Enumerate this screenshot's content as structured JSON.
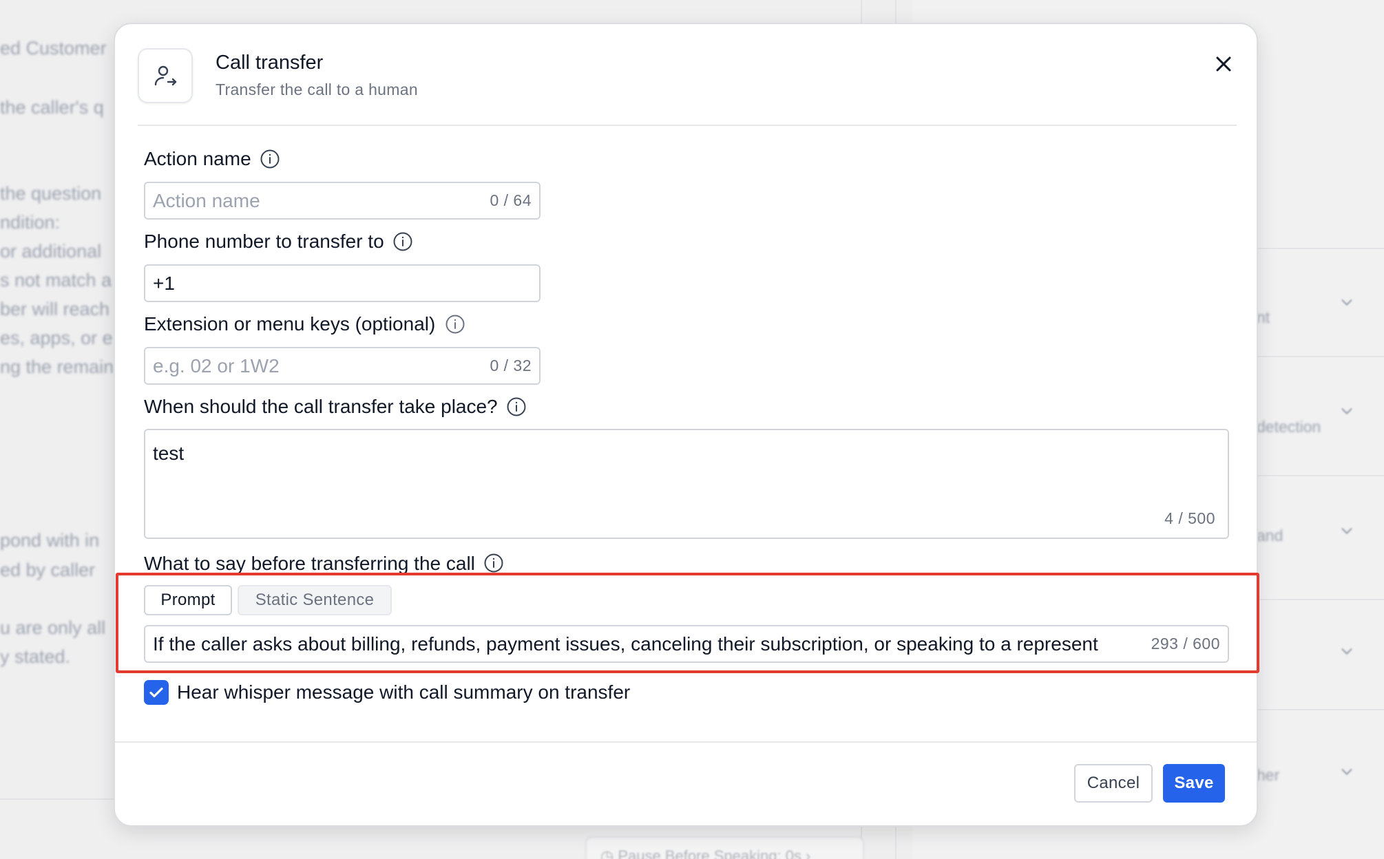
{
  "background": {
    "left_lines": [
      "ed Customer",
      "the caller's q",
      "the question",
      "ndition:",
      "or additional",
      "s not match a",
      "ber will reach",
      "es, apps, or e",
      "ng the remain",
      "pond with in",
      "ed by caller",
      "u are only all",
      "y stated."
    ],
    "right_items": [
      "nt",
      "detection",
      "and",
      "",
      "her"
    ],
    "pause_pill": "Pause Before Speaking: 0s"
  },
  "modal": {
    "title": "Call transfer",
    "subtitle": "Transfer the call to a human",
    "icon": "user-transfer-icon",
    "close_icon": "close-icon"
  },
  "form": {
    "action_name": {
      "label": "Action name",
      "placeholder": "Action name",
      "value": "",
      "counter": "0 / 64"
    },
    "phone": {
      "label": "Phone number to transfer to",
      "value": "+1"
    },
    "extension": {
      "label": "Extension or menu keys (optional)",
      "placeholder": "e.g. 02 or 1W2",
      "counter": "0 / 32"
    },
    "when": {
      "label": "When should the call transfer take place?",
      "value": "test",
      "counter": "4 / 500"
    },
    "say": {
      "label": "What to say before transferring the call",
      "tabs": [
        "Prompt",
        "Static Sentence"
      ],
      "active_tab": "Prompt",
      "value": "If the caller asks about billing, refunds, payment issues, canceling their subscription, or speaking to a represent",
      "counter": "293 / 600"
    },
    "whisper": {
      "label": "Hear whisper message with call summary on transfer",
      "checked": true
    }
  },
  "footer": {
    "cancel_label": "Cancel",
    "save_label": "Save"
  },
  "colors": {
    "accent": "#2563eb",
    "highlight": "#e53a2f"
  }
}
